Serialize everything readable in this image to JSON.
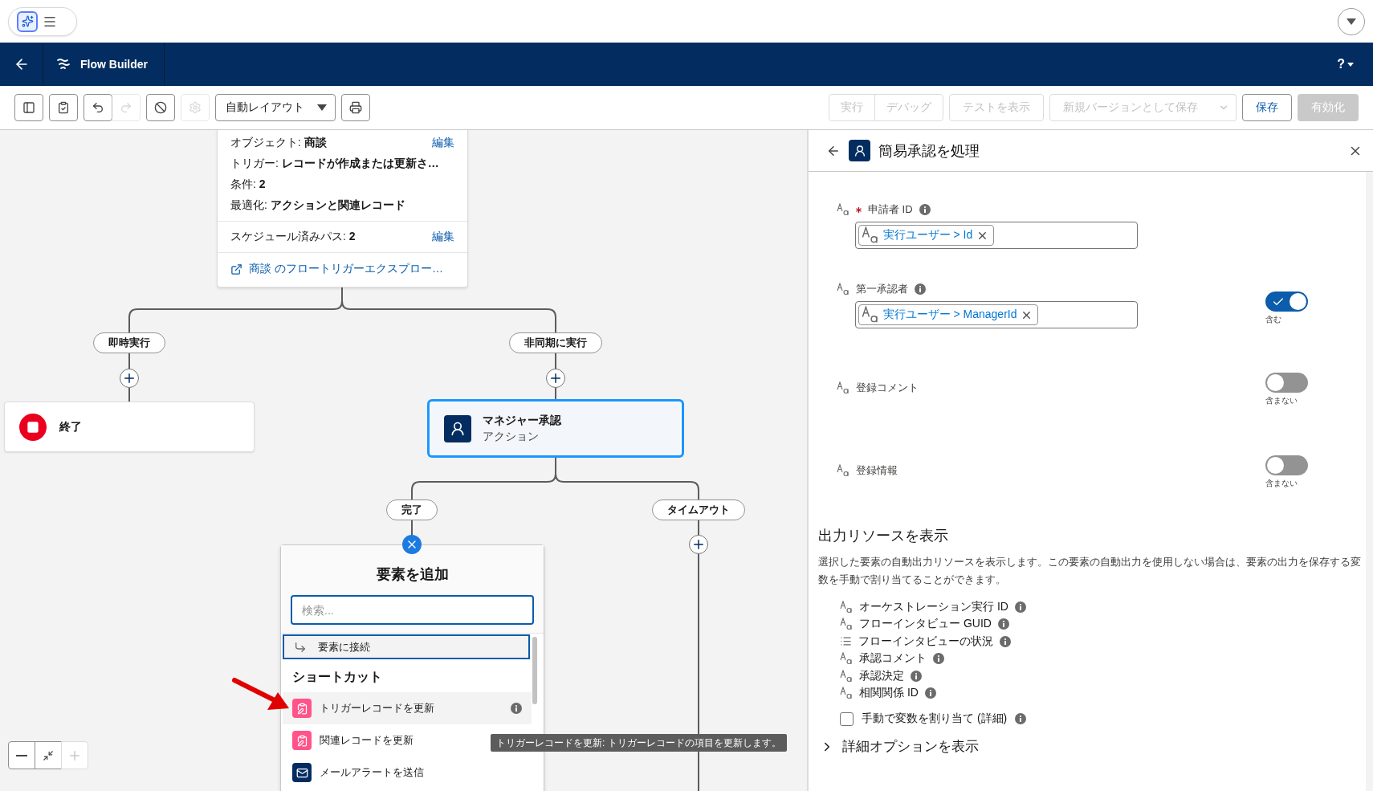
{
  "nav": {
    "title": "Flow Builder",
    "help": "?"
  },
  "toolbar": {
    "tools": [
      {
        "kind": "panel",
        "disabled": false
      },
      {
        "kind": "check",
        "disabled": false
      },
      {
        "kind": "undo",
        "disabled": false
      },
      {
        "kind": "redo",
        "disabled": true
      },
      {
        "kind": "block",
        "disabled": false
      },
      {
        "kind": "gear",
        "disabled": true
      },
      {
        "kind": "select",
        "label": "自動レイアウト"
      },
      {
        "kind": "print",
        "disabled": false
      }
    ],
    "actions": [
      {
        "label": "実行",
        "kind": "group",
        "disabled": true
      },
      {
        "label": "デバッグ",
        "kind": "group",
        "disabled": true
      },
      {
        "label": "テストを表示",
        "kind": "single",
        "disabled": true
      },
      {
        "label": "新規バージョンとして保存",
        "kind": "split",
        "disabled": true
      },
      {
        "label": "保存",
        "kind": "single",
        "disabled": false
      },
      {
        "label": "有効化",
        "kind": "brand",
        "disabled": true
      }
    ]
  },
  "canvas": {
    "trigger_card": {
      "rows": [
        {
          "label": "オブジェクト:",
          "value": "商談",
          "action": "編集"
        },
        {
          "label": "トリガー:",
          "value": "レコードが作成または更新さ…"
        },
        {
          "label": "条件:",
          "value": "2"
        },
        {
          "label": "最適化:",
          "value": "アクションと関連レコード"
        }
      ],
      "schedule": {
        "label": "スケジュール済みパス:",
        "value": "2",
        "action": "編集"
      },
      "explorer_link": "商談 のフロートリガーエクスプロー…"
    },
    "branches": [
      {
        "label": "即時実行"
      },
      {
        "label": "非同期に実行"
      }
    ],
    "end_node": {
      "label": "終了"
    },
    "action_node": {
      "title": "マネジャー承認",
      "subtitle": "アクション",
      "selected": true
    },
    "sub_branches": [
      {
        "label": "完了"
      },
      {
        "label": "タイムアウト"
      }
    ],
    "add_panel": {
      "title": "要素を追加",
      "search": {
        "placeholder": "検索..."
      },
      "connect_item": "要素に接続",
      "section": "ショートカット",
      "items": [
        {
          "label": "トリガーレコードを更新",
          "kind": "record",
          "highlighted": true
        },
        {
          "label": "関連レコードを更新",
          "kind": "record",
          "highlighted": false
        },
        {
          "label": "メールアラートを送信",
          "kind": "email",
          "highlighted": false
        }
      ]
    },
    "tooltip": "トリガーレコードを更新: トリガーレコードの項目を更新します。"
  },
  "panel": {
    "title": "簡易承認を処理",
    "fields": [
      {
        "label": "申請者 ID",
        "required": true,
        "info": true,
        "value": "実行ユーザー > Id"
      },
      {
        "label": "第一承認者",
        "required": false,
        "info": true,
        "value": "実行ユーザー > ManagerId",
        "toggle": {
          "on": true,
          "caption": "含む"
        }
      },
      {
        "label": "登録コメント",
        "required": false,
        "info": false,
        "toggle": {
          "on": false,
          "caption": "含まない"
        }
      },
      {
        "label": "登録情報",
        "required": false,
        "info": false,
        "toggle": {
          "on": false,
          "caption": "含まない"
        }
      }
    ],
    "output": {
      "heading": "出力リソースを表示",
      "description": "選択した要素の自動出力リソースを表示します。この要素の自動出力を使用しない場合は、要素の出力を保存する変数を手動で割り当てることができます。",
      "resources": [
        {
          "label": "オーケストレーション実行 ID",
          "kind": "text"
        },
        {
          "label": "フローインタビュー GUID",
          "kind": "text"
        },
        {
          "label": "フローインタビューの状況",
          "kind": "list"
        },
        {
          "label": "承認コメント",
          "kind": "text"
        },
        {
          "label": "承認決定",
          "kind": "text"
        },
        {
          "label": "相関関係 ID",
          "kind": "text"
        }
      ],
      "manual_assign": {
        "label": "手動で変数を割り当て (詳細)",
        "checked": false
      },
      "advanced": {
        "label": "詳細オプションを表示",
        "expanded": false
      }
    }
  }
}
